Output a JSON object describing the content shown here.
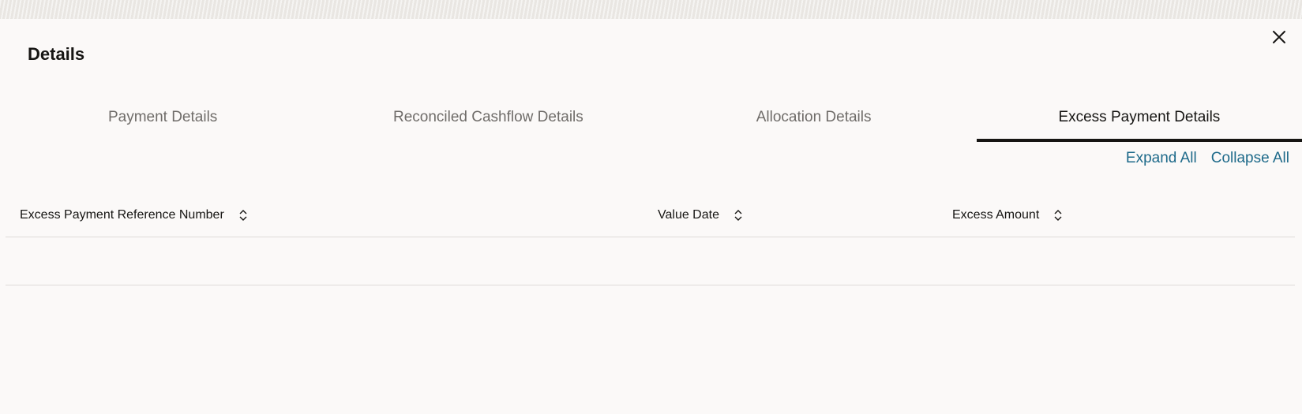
{
  "dialog": {
    "title": "Details",
    "close_icon": "close-icon"
  },
  "tabs": [
    {
      "label": "Payment Details",
      "active": false
    },
    {
      "label": "Reconciled Cashflow Details",
      "active": false
    },
    {
      "label": "Allocation Details",
      "active": false
    },
    {
      "label": "Excess Payment Details",
      "active": true
    }
  ],
  "actions": {
    "expand_all": "Expand All",
    "collapse_all": "Collapse All"
  },
  "table": {
    "columns": [
      {
        "label": "Excess Payment Reference Number",
        "sort_icon": "sort-icon"
      },
      {
        "label": "Value Date",
        "sort_icon": "sort-icon"
      },
      {
        "label": "Excess Amount",
        "sort_icon": "sort-icon"
      }
    ],
    "rows": []
  },
  "colors": {
    "accent_link": "#1e6a8a",
    "active_tab_underline": "#161513",
    "background": "#fbf9f8"
  }
}
